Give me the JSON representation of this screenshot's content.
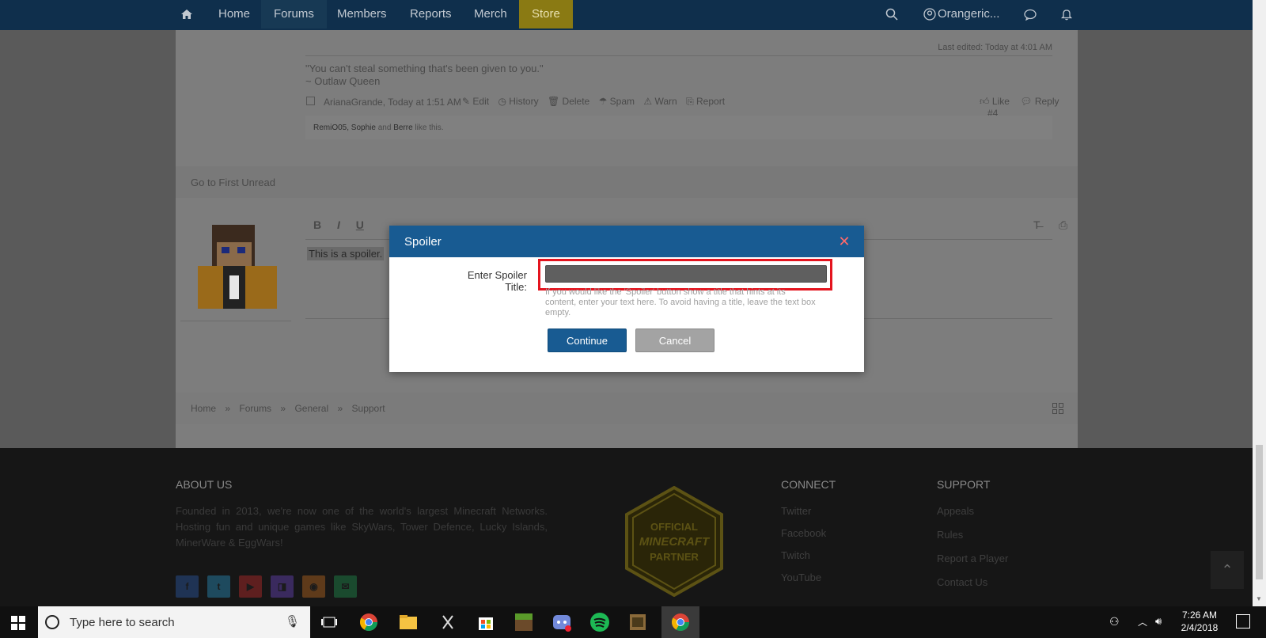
{
  "nav": {
    "items": [
      "Home",
      "Forums",
      "Members",
      "Reports",
      "Merch",
      "Store"
    ],
    "username": "Orangeric..."
  },
  "post": {
    "last_edited": "Last edited: Today at 4:01 AM",
    "quote_line1": "\"You can't steal something that's been given to you.\"",
    "quote_line2": "~ Outlaw Queen",
    "author_meta": "ArianaGrande, Today at 1:51 AM",
    "actions": [
      "Edit",
      "History",
      "Delete",
      "Spam",
      "Warn",
      "Report"
    ],
    "like": "Like",
    "reply": "Reply",
    "post_number": "#4",
    "likes_text_users": "RemiO05, Sophie",
    "likes_text_and": "and",
    "likes_text_last": "Berre",
    "likes_text_suffix": "like this."
  },
  "go_first_unread": "Go to First Unread",
  "editor": {
    "toolbar": [
      "B",
      "I",
      "U"
    ],
    "content": "This is a spoiler."
  },
  "breadcrumb": [
    "Home",
    "Forums",
    "General",
    "Support"
  ],
  "breadcrumb_sep": "»",
  "footer": {
    "about_title": "ABOUT US",
    "about_text": "Founded in 2013, we're now one of the world's largest Minecraft Networks. Hosting fun and unique games like SkyWars, Tower Defence, Lucky Islands, MinerWare & EggWars!",
    "badge_top": "OFFICIAL",
    "badge_mid": "MINECRAFT",
    "badge_bottom": "PARTNER",
    "connect_title": "CONNECT",
    "connect_links": [
      "Twitter",
      "Facebook",
      "Twitch",
      "YouTube"
    ],
    "support_title": "SUPPORT",
    "support_links": [
      "Appeals",
      "Rules",
      "Report a Player",
      "Contact Us"
    ]
  },
  "modal": {
    "title": "Spoiler",
    "label": "Enter Spoiler Title:",
    "input_value": "",
    "hint": "If you would like the 'Spoiler' button show a title that hints at its content, enter your text here. To avoid having a title, leave the text box empty.",
    "continue": "Continue",
    "cancel": "Cancel"
  },
  "taskbar": {
    "search_placeholder": "Type here to search",
    "time": "7:26 AM",
    "date": "2/4/2018"
  },
  "colors": {
    "nav_bg": "#0f2f4c",
    "store_bg": "#8a7a13",
    "modal_header": "#185b92",
    "highlight": "#e4141e"
  }
}
